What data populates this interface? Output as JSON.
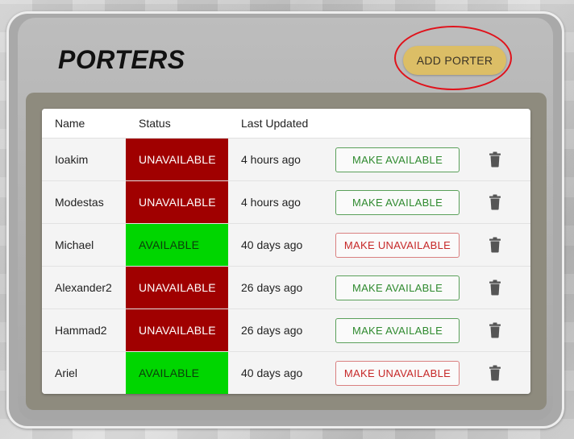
{
  "page": {
    "title": "PORTERS",
    "add_button_label": "ADD PORTER"
  },
  "table": {
    "columns": [
      "Name",
      "Status",
      "Last Updated"
    ],
    "rows": [
      {
        "name": "Ioakim",
        "status": "UNAVAILABLE",
        "updated": "4 hours ago",
        "action": "MAKE AVAILABLE"
      },
      {
        "name": "Modestas",
        "status": "UNAVAILABLE",
        "updated": "4 hours ago",
        "action": "MAKE AVAILABLE"
      },
      {
        "name": "Michael",
        "status": "AVAILABLE",
        "updated": "40 days ago",
        "action": "MAKE UNAVAILABLE"
      },
      {
        "name": "Alexander2",
        "status": "UNAVAILABLE",
        "updated": "26 days ago",
        "action": "MAKE AVAILABLE"
      },
      {
        "name": "Hammad2",
        "status": "UNAVAILABLE",
        "updated": "26 days ago",
        "action": "MAKE AVAILABLE"
      },
      {
        "name": "Ariel",
        "status": "AVAILABLE",
        "updated": "40 days ago",
        "action": "MAKE UNAVAILABLE"
      }
    ]
  },
  "icons": {
    "delete": "trash-icon"
  },
  "colors": {
    "unavailable": "#a00000",
    "available": "#00d600",
    "add_button": "#dcbe66",
    "highlight": "#e0121b"
  }
}
